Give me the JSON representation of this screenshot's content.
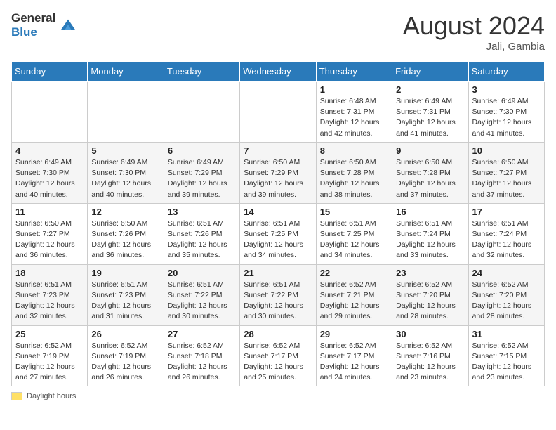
{
  "header": {
    "logo_line1": "General",
    "logo_line2": "Blue",
    "month_year": "August 2024",
    "location": "Jali, Gambia"
  },
  "days_of_week": [
    "Sunday",
    "Monday",
    "Tuesday",
    "Wednesday",
    "Thursday",
    "Friday",
    "Saturday"
  ],
  "footer": {
    "swatch_label": "Daylight hours"
  },
  "weeks": [
    {
      "days": [
        {
          "number": "",
          "info": ""
        },
        {
          "number": "",
          "info": ""
        },
        {
          "number": "",
          "info": ""
        },
        {
          "number": "",
          "info": ""
        },
        {
          "number": "1",
          "info": "Sunrise: 6:48 AM\nSunset: 7:31 PM\nDaylight: 12 hours and 42 minutes."
        },
        {
          "number": "2",
          "info": "Sunrise: 6:49 AM\nSunset: 7:31 PM\nDaylight: 12 hours and 41 minutes."
        },
        {
          "number": "3",
          "info": "Sunrise: 6:49 AM\nSunset: 7:30 PM\nDaylight: 12 hours and 41 minutes."
        }
      ]
    },
    {
      "days": [
        {
          "number": "4",
          "info": "Sunrise: 6:49 AM\nSunset: 7:30 PM\nDaylight: 12 hours and 40 minutes."
        },
        {
          "number": "5",
          "info": "Sunrise: 6:49 AM\nSunset: 7:30 PM\nDaylight: 12 hours and 40 minutes."
        },
        {
          "number": "6",
          "info": "Sunrise: 6:49 AM\nSunset: 7:29 PM\nDaylight: 12 hours and 39 minutes."
        },
        {
          "number": "7",
          "info": "Sunrise: 6:50 AM\nSunset: 7:29 PM\nDaylight: 12 hours and 39 minutes."
        },
        {
          "number": "8",
          "info": "Sunrise: 6:50 AM\nSunset: 7:28 PM\nDaylight: 12 hours and 38 minutes."
        },
        {
          "number": "9",
          "info": "Sunrise: 6:50 AM\nSunset: 7:28 PM\nDaylight: 12 hours and 37 minutes."
        },
        {
          "number": "10",
          "info": "Sunrise: 6:50 AM\nSunset: 7:27 PM\nDaylight: 12 hours and 37 minutes."
        }
      ]
    },
    {
      "days": [
        {
          "number": "11",
          "info": "Sunrise: 6:50 AM\nSunset: 7:27 PM\nDaylight: 12 hours and 36 minutes."
        },
        {
          "number": "12",
          "info": "Sunrise: 6:50 AM\nSunset: 7:26 PM\nDaylight: 12 hours and 36 minutes."
        },
        {
          "number": "13",
          "info": "Sunrise: 6:51 AM\nSunset: 7:26 PM\nDaylight: 12 hours and 35 minutes."
        },
        {
          "number": "14",
          "info": "Sunrise: 6:51 AM\nSunset: 7:25 PM\nDaylight: 12 hours and 34 minutes."
        },
        {
          "number": "15",
          "info": "Sunrise: 6:51 AM\nSunset: 7:25 PM\nDaylight: 12 hours and 34 minutes."
        },
        {
          "number": "16",
          "info": "Sunrise: 6:51 AM\nSunset: 7:24 PM\nDaylight: 12 hours and 33 minutes."
        },
        {
          "number": "17",
          "info": "Sunrise: 6:51 AM\nSunset: 7:24 PM\nDaylight: 12 hours and 32 minutes."
        }
      ]
    },
    {
      "days": [
        {
          "number": "18",
          "info": "Sunrise: 6:51 AM\nSunset: 7:23 PM\nDaylight: 12 hours and 32 minutes."
        },
        {
          "number": "19",
          "info": "Sunrise: 6:51 AM\nSunset: 7:23 PM\nDaylight: 12 hours and 31 minutes."
        },
        {
          "number": "20",
          "info": "Sunrise: 6:51 AM\nSunset: 7:22 PM\nDaylight: 12 hours and 30 minutes."
        },
        {
          "number": "21",
          "info": "Sunrise: 6:51 AM\nSunset: 7:22 PM\nDaylight: 12 hours and 30 minutes."
        },
        {
          "number": "22",
          "info": "Sunrise: 6:52 AM\nSunset: 7:21 PM\nDaylight: 12 hours and 29 minutes."
        },
        {
          "number": "23",
          "info": "Sunrise: 6:52 AM\nSunset: 7:20 PM\nDaylight: 12 hours and 28 minutes."
        },
        {
          "number": "24",
          "info": "Sunrise: 6:52 AM\nSunset: 7:20 PM\nDaylight: 12 hours and 28 minutes."
        }
      ]
    },
    {
      "days": [
        {
          "number": "25",
          "info": "Sunrise: 6:52 AM\nSunset: 7:19 PM\nDaylight: 12 hours and 27 minutes."
        },
        {
          "number": "26",
          "info": "Sunrise: 6:52 AM\nSunset: 7:19 PM\nDaylight: 12 hours and 26 minutes."
        },
        {
          "number": "27",
          "info": "Sunrise: 6:52 AM\nSunset: 7:18 PM\nDaylight: 12 hours and 26 minutes."
        },
        {
          "number": "28",
          "info": "Sunrise: 6:52 AM\nSunset: 7:17 PM\nDaylight: 12 hours and 25 minutes."
        },
        {
          "number": "29",
          "info": "Sunrise: 6:52 AM\nSunset: 7:17 PM\nDaylight: 12 hours and 24 minutes."
        },
        {
          "number": "30",
          "info": "Sunrise: 6:52 AM\nSunset: 7:16 PM\nDaylight: 12 hours and 23 minutes."
        },
        {
          "number": "31",
          "info": "Sunrise: 6:52 AM\nSunset: 7:15 PM\nDaylight: 12 hours and 23 minutes."
        }
      ]
    }
  ]
}
